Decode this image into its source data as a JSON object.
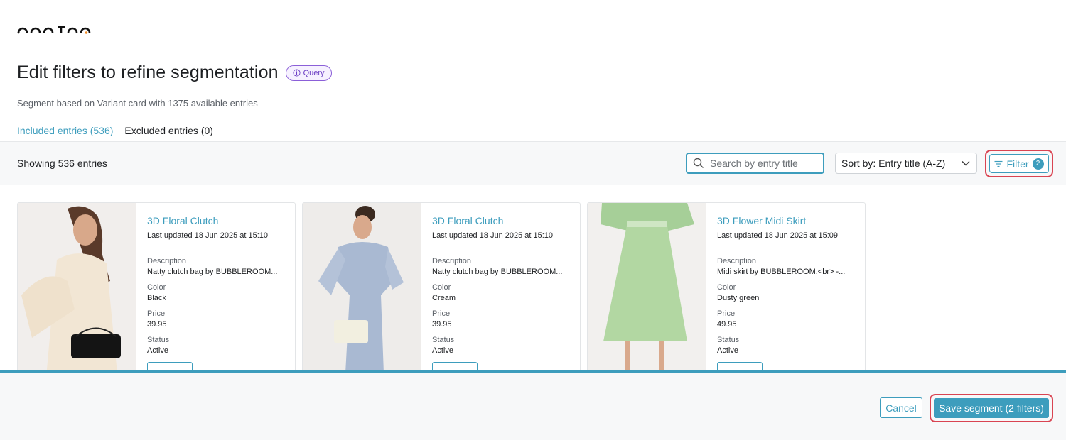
{
  "brand": {
    "logo_text": "occtoo",
    "accent_dot_color": "#f08a24"
  },
  "header": {
    "title": "Edit filters to refine segmentation",
    "badge_label": "Query",
    "badge_icon": "info-icon",
    "subtitle": "Segment based on Variant card with 1375 available entries"
  },
  "tabs": [
    {
      "label": "Included entries (536)",
      "active": true
    },
    {
      "label": "Excluded entries (0)",
      "active": false
    }
  ],
  "toolbar": {
    "showing_text": "Showing 536 entries",
    "search_placeholder": "Search by entry title",
    "search_icon": "search-icon",
    "sort_label": "Sort by: Entry title (A-Z)",
    "filter_label": "Filter",
    "filter_count": "2"
  },
  "cards": [
    {
      "title": "3D Floral Clutch",
      "updated": "Last updated 18 Jun 2025 at 15:10",
      "description_label": "Description",
      "description": "Natty clutch bag by BUBBLEROOM...",
      "color_label": "Color",
      "color": "Black",
      "price_label": "Price",
      "price": "39.95",
      "status_label": "Status",
      "status": "Active"
    },
    {
      "title": "3D Floral Clutch",
      "updated": "Last updated 18 Jun 2025 at 15:10",
      "description_label": "Description",
      "description": "Natty clutch bag by BUBBLEROOM...",
      "color_label": "Color",
      "color": "Cream",
      "price_label": "Price",
      "price": "39.95",
      "status_label": "Status",
      "status": "Active"
    },
    {
      "title": "3D Flower Midi Skirt",
      "updated": "Last updated 18 Jun 2025 at 15:09",
      "description_label": "Description",
      "description": "Midi skirt by BUBBLEROOM.<br> -...",
      "color_label": "Color",
      "color": "Dusty green",
      "price_label": "Price",
      "price": "49.95",
      "status_label": "Status",
      "status": "Active"
    }
  ],
  "footer": {
    "cancel_label": "Cancel",
    "save_label": "Save segment (2 filters)"
  },
  "colors": {
    "accent": "#3d9dbd",
    "highlight": "#d94452",
    "badge": "#6c3fc4"
  }
}
